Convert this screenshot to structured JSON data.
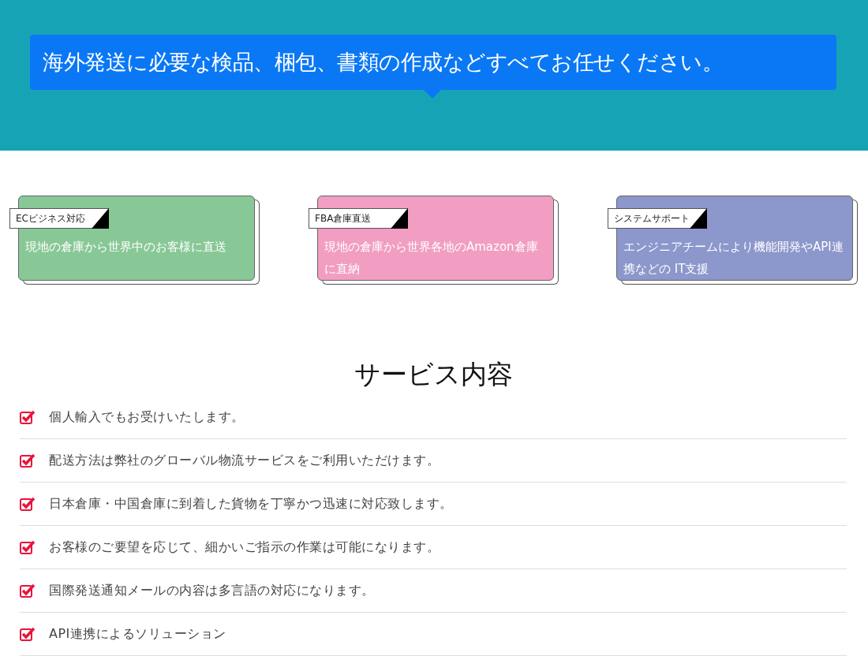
{
  "banner": {
    "message": "海外発送に必要な検品、梱包、書類の作成などすべてお任せください。"
  },
  "features": [
    {
      "tag": "ECビジネス対応",
      "text": "現地の倉庫から世界中のお客様に直送",
      "color": "#88c896"
    },
    {
      "tag": "FBA倉庫直送",
      "text": "現地の倉庫から世界各地のAmazon倉庫に直納",
      "color": "#f19ec2"
    },
    {
      "tag": "システムサポート",
      "text": "エンジニアチームにより機能開発やAPI連携などの IT支援",
      "color": "#8c97cb"
    }
  ],
  "services": {
    "title": "サービス内容",
    "items": [
      "個人輸入でもお受けいたします。",
      "配送方法は弊社のグローバル物流サービスをご利用いただけます。",
      "日本倉庫・中国倉庫に到着した貨物を丁寧かつ迅速に対応致します。",
      "お客様のご要望を応じて、細かいご指示の作業は可能になります。",
      "国際発送通知メールの内容は多言語の対応になります。",
      "API連携によるソリューション"
    ]
  }
}
